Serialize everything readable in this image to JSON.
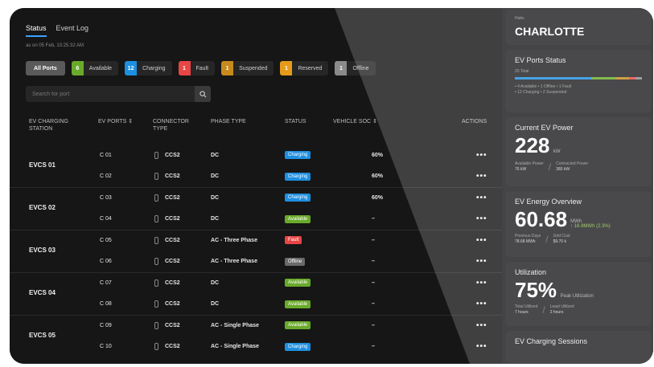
{
  "tabs": [
    {
      "label": "Status"
    },
    {
      "label": "Event Log"
    }
  ],
  "as_of": "as on 05 Feb, 10:25:32 AM",
  "filters": [
    {
      "label": "All Ports"
    },
    {
      "count": "6",
      "label": "Available",
      "color": "#6aaa2a"
    },
    {
      "count": "12",
      "label": "Charging",
      "color": "#1e8fe0"
    },
    {
      "count": "1",
      "label": "Fault",
      "color": "#e84545"
    },
    {
      "count": "1",
      "label": "Suspended",
      "color": "#c98a1c"
    },
    {
      "count": "1",
      "label": "Reserved",
      "color": "#e69b1a"
    },
    {
      "count": "1",
      "label": "Offline",
      "color": "#8a8a8a"
    }
  ],
  "search": {
    "placeholder": "Search for port"
  },
  "table": {
    "headers": {
      "station": "EV Charging Station",
      "ports": "EV Ports ⇕",
      "connector": "Connector Type",
      "phase": "Phase Type",
      "status": "Status",
      "soc": "Vehicle SOC ⇕",
      "actions": "Actions"
    },
    "stations": [
      "EVCS 01",
      "EVCS 02",
      "EVCS 03",
      "EVCS 04",
      "EVCS 05"
    ],
    "rows": [
      {
        "port": "C 01",
        "connector": "CCS2",
        "phase": "DC",
        "status": "Charging",
        "soc": "60%",
        "actions": "•••"
      },
      {
        "port": "C 02",
        "connector": "CCS2",
        "phase": "DC",
        "status": "Charging",
        "soc": "60%",
        "actions": "•••"
      },
      {
        "port": "C 03",
        "connector": "CCS2",
        "phase": "DC",
        "status": "Charging",
        "soc": "60%",
        "actions": "•••"
      },
      {
        "port": "C 04",
        "connector": "CCS2",
        "phase": "DC",
        "status": "Available",
        "soc": "–",
        "actions": "•••"
      },
      {
        "port": "C 05",
        "connector": "CCS2",
        "phase": "AC - Three Phase",
        "status": "Fault",
        "soc": "–",
        "actions": "•••"
      },
      {
        "port": "C 06",
        "connector": "CCS2",
        "phase": "AC - Three Phase",
        "status": "Offline",
        "soc": "–",
        "actions": "•••"
      },
      {
        "port": "C 07",
        "connector": "CCS2",
        "phase": "DC",
        "status": "Available",
        "soc": "–",
        "actions": "•••"
      },
      {
        "port": "C 08",
        "connector": "CCS2",
        "phase": "DC",
        "status": "Available",
        "soc": "–",
        "actions": "•••"
      },
      {
        "port": "C 09",
        "connector": "CCS2",
        "phase": "AC - Single Phase",
        "status": "Available",
        "soc": "–",
        "actions": "•••"
      },
      {
        "port": "C 10",
        "connector": "CCS2",
        "phase": "AC - Single Phase",
        "status": "Charging",
        "soc": "–",
        "actions": "•••"
      }
    ]
  },
  "status_colors": {
    "Charging": "#1e8fe0",
    "Available": "#6aaa2a",
    "Fault": "#e84545",
    "Offline": "#6a6a6a"
  },
  "right": {
    "site_label": "Hubs",
    "site_name": "CHARLOTTE",
    "ports_status": {
      "title": "EV Ports Status",
      "total": "20 Total",
      "line1": "• 4 Available  • 1 Offline  • 1 Fault",
      "line2": "• 12 Charging  • 2 Suspended"
    },
    "power": {
      "title": "Current EV Power",
      "value": "228",
      "unit": "kW",
      "a_label": "Available Power",
      "a_value": "76 kW",
      "b_label": "Contracted Power",
      "b_value": "380 kW"
    },
    "energy": {
      "title": "EV Energy Overview",
      "value": "60.68",
      "unit": "MWh",
      "delta": "↑ 16.9MWh (2.3%)",
      "a_label": "Previous Days",
      "a_value": "78.68 MWh",
      "b_label": "Grid Cost",
      "b_value": "$9.70 k"
    },
    "utilization": {
      "title": "Utilization",
      "value": "75%",
      "note": "Peak Utilization",
      "a_label": "Total Utilized",
      "a_value": "7 hours",
      "b_label": "Least Utilized",
      "b_value": "2 hours"
    },
    "sessions": {
      "title": "EV Charging Sessions"
    }
  }
}
